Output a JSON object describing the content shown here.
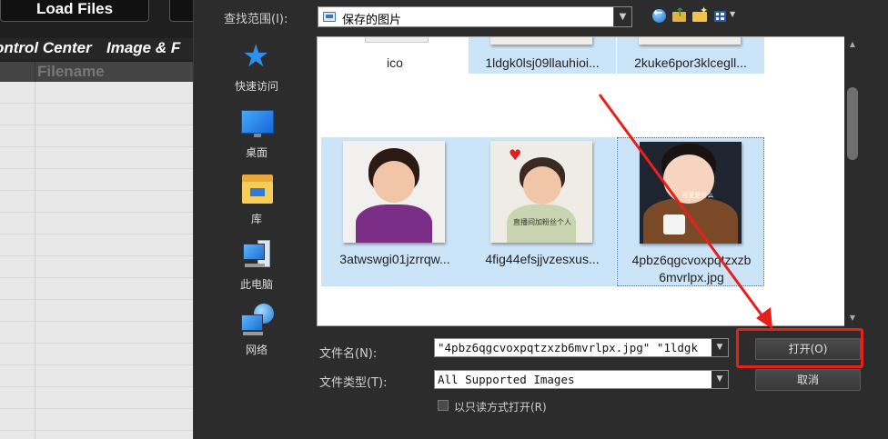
{
  "background_app": {
    "load_files_label": "Load Files",
    "tabs": [
      "ontrol Center",
      "Image & F"
    ],
    "column_header": "Filename"
  },
  "dialog": {
    "look_in_label": "查找范围(I):",
    "look_in_value": "保存的图片",
    "places": [
      {
        "label": "快速访问",
        "icon": "star-icon"
      },
      {
        "label": "桌面",
        "icon": "desktop-icon"
      },
      {
        "label": "库",
        "icon": "library-icon"
      },
      {
        "label": "此电脑",
        "icon": "computer-icon"
      },
      {
        "label": "网络",
        "icon": "network-icon"
      }
    ],
    "files_row1": [
      "ico",
      "1ldgk0lsj09llauhioi...",
      "2kuke6por3klcegll..."
    ],
    "files_row2": [
      "3atwswgi01jzrrqw...",
      "4fig44efsjjvzesxus...",
      "4pbz6qgcvoxpqtzxzb",
      "6mvrlpx.jpg"
    ],
    "badge_text_1": "直播间加粉丝个人",
    "badge_text_2": "可爱是什么",
    "file_name_label": "文件名(N):",
    "file_name_value": "\"4pbz6qgcvoxpqtzxzb6mvrlpx.jpg\" \"1ldgk",
    "file_type_label": "文件类型(T):",
    "file_type_value": "All Supported Images",
    "readonly_label": "以只读方式打开(R)",
    "open_label": "打开(O)",
    "cancel_label": "取消"
  },
  "colors": {
    "selection": "#cce4f7",
    "highlight_red": "#e8201c"
  }
}
